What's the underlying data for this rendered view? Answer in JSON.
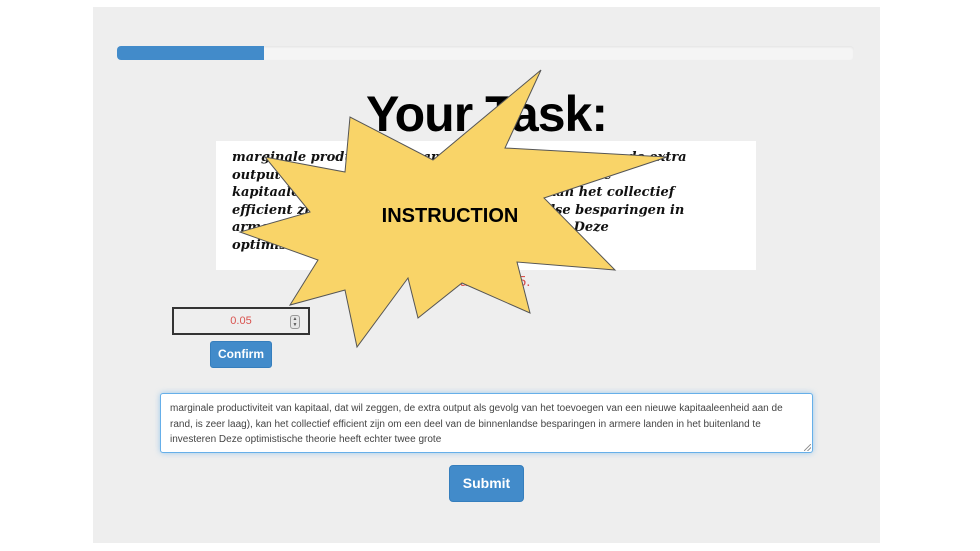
{
  "progress": {
    "fraction": 0.2,
    "color": "#428bca"
  },
  "task": {
    "heading": "Your Task:",
    "captcha_lines": [
      "marginale productiviteit van kapitaal, dat wil zeggen, de extra",
      "output als gevolg van het toevoegen van een nieuwe",
      "kapitaaleenheid aan de rand, is zeer laag), kan het collectief",
      "efficient zijn om een deel van de binnenlandse besparingen in",
      "armere landen in het buitenland te investeren Deze",
      "optimistische theorie"
    ],
    "reward_prefix": "You get ",
    "reward_value": "0.05",
    "reward_suffix": "."
  },
  "bid": {
    "value": "0.05",
    "confirm_label": "Confirm"
  },
  "answer": {
    "text": "marginale productiviteit van kapitaal, dat wil zeggen, de extra output als gevolg van het toevoegen van een nieuwe kapitaaleenheid aan de rand, is zeer laag), kan het collectief efficient zijn om een deel van de binnenlandse besparingen in armere landen in het buitenland te investeren Deze optimistische theorie heeft echter twee grote"
  },
  "submit_label": "Submit",
  "overlay": {
    "label": "INSTRUCTION",
    "fill": "#f9d468",
    "stroke": "#555555"
  },
  "colors": {
    "accent": "#428bca",
    "error": "#d9534f",
    "background": "#eeeeee"
  }
}
